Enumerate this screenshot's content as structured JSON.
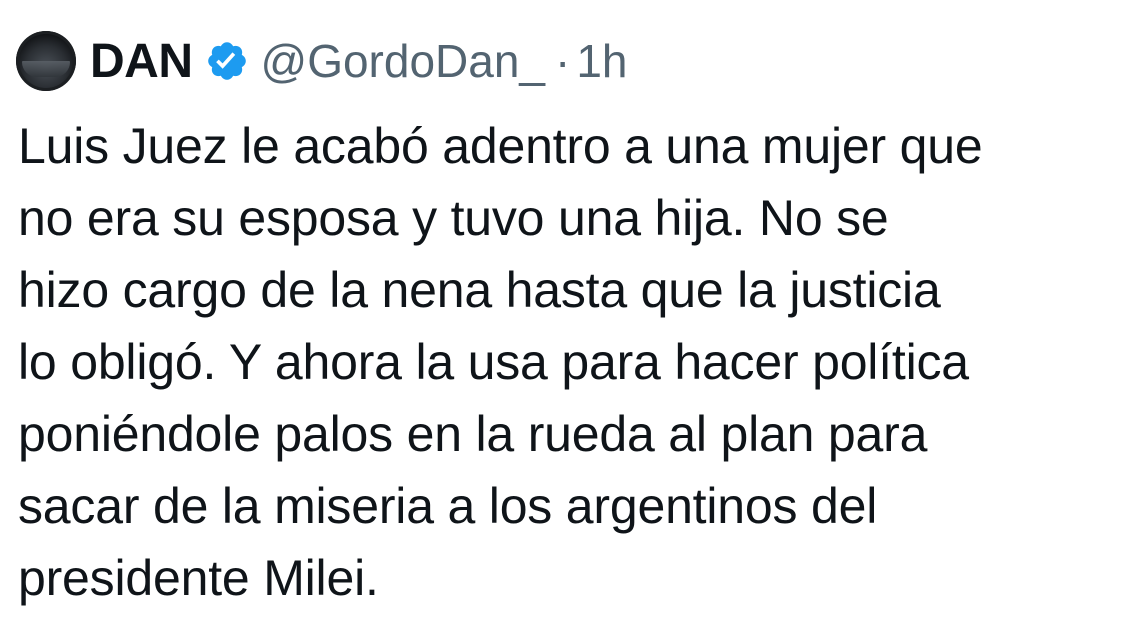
{
  "tweet": {
    "author": {
      "display_name": "DAN",
      "handle": "@GordoDan_",
      "verified_icon": "verified-badge-icon",
      "avatar_icon": "avatar-image"
    },
    "separator": "·",
    "time": "1h",
    "text_lines": [
      "Luis Juez le acabó adentro a una mujer que",
      "no era su esposa y tuvo una hija. No se",
      "hizo cargo de la nena hasta que la justicia",
      "lo obligó. Y ahora la usa para hacer política",
      "poniéndole palos en la rueda al plan para",
      "sacar de la miseria a los argentinos del",
      "presidente Milei."
    ]
  },
  "colors": {
    "text_primary": "#0f1419",
    "text_secondary": "#536471",
    "verified_blue": "#1d9bf0",
    "background": "#ffffff"
  }
}
